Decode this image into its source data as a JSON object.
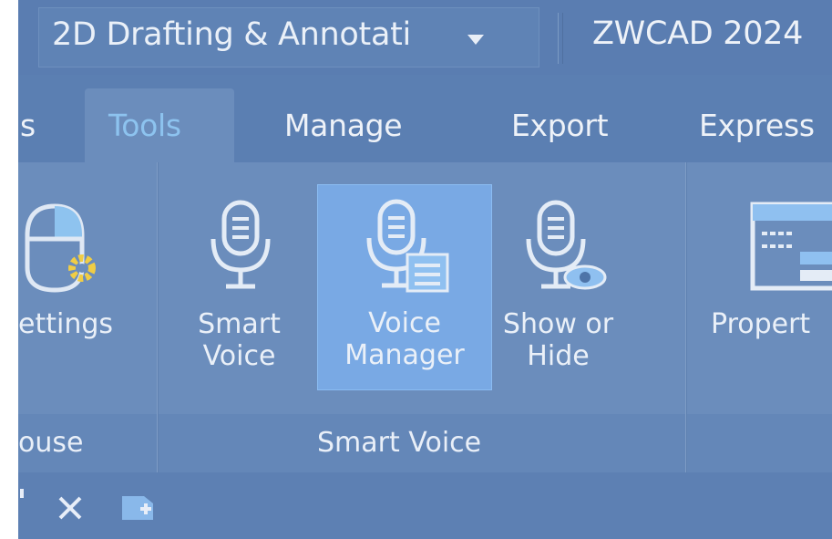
{
  "titlebar": {
    "workspace_label": "2D Drafting & Annotati",
    "app_title": "ZWCAD 2024"
  },
  "tabs": [
    {
      "label": "s"
    },
    {
      "label": "Tools"
    },
    {
      "label": "Manage"
    },
    {
      "label": "Export"
    },
    {
      "label": "Express"
    }
  ],
  "ribbon": {
    "settings_label": "ettings",
    "smart_voice_label": "Smart\nVoice",
    "voice_manager_label": "Voice\nManager",
    "show_hide_label": "Show or\nHide",
    "properties_label": "Propert",
    "panel_mouse_label": "ouse",
    "panel_smart_voice_label": "Smart Voice"
  },
  "colors": {
    "active_tab_text": "#8dc3ef",
    "selected_button_bg": "#79a9e4",
    "ribbon_bg": "#6b8dbc"
  }
}
